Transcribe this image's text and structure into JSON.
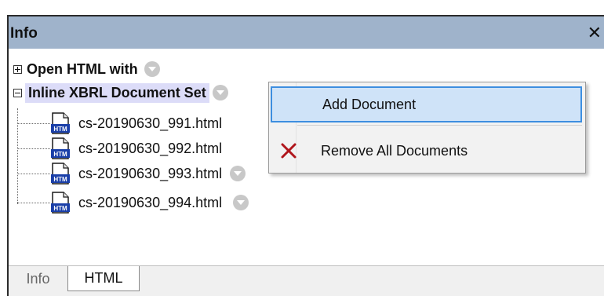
{
  "panel": {
    "title": "Info",
    "close_glyph": "✕"
  },
  "tree": {
    "root_items": [
      {
        "label": "Open HTML with",
        "expander": "plus"
      },
      {
        "label": "Inline XBRL Document Set",
        "expander": "minus"
      }
    ],
    "files": [
      {
        "name": "cs-20190630_991.html",
        "icon": "htm-file-icon"
      },
      {
        "name": "cs-20190630_992.html",
        "icon": "htm-file-icon"
      },
      {
        "name": "cs-20190630_993.html",
        "icon": "htm-file-icon"
      },
      {
        "name": "cs-20190630_994.html",
        "icon": "htm-file-icon"
      }
    ],
    "file_icon_text": "HTM"
  },
  "context_menu": {
    "items": [
      {
        "label": "Add Document",
        "highlighted": true
      },
      {
        "label": "Remove All Documents",
        "icon": "remove-x-icon"
      }
    ]
  },
  "tabs": [
    {
      "label": "Info",
      "active": false
    },
    {
      "label": "HTML",
      "active": true
    }
  ],
  "colors": {
    "titlebar": "#9fb3cb",
    "selection": "#dcdcf8",
    "menu_highlight": "#cfe3f8",
    "menu_highlight_border": "#3d8ee0",
    "remove_icon": "#b0161c"
  }
}
